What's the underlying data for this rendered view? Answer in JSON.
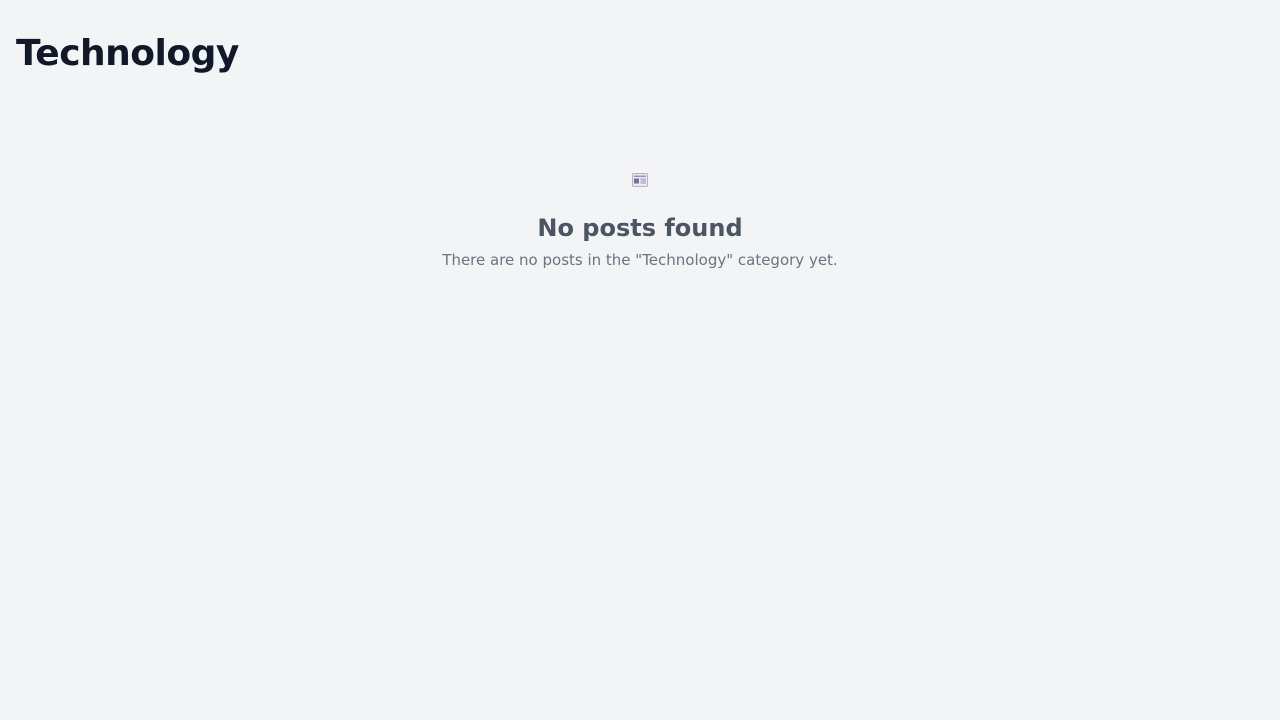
{
  "page": {
    "title": "Technology"
  },
  "empty_state": {
    "icon": "newspaper-icon",
    "heading": "No posts found",
    "message": "There are no posts in the \"Technology\" category yet."
  },
  "colors": {
    "background": "#f3f4f6",
    "title": "#111827",
    "heading": "#4b5563",
    "message": "#6b7280"
  }
}
